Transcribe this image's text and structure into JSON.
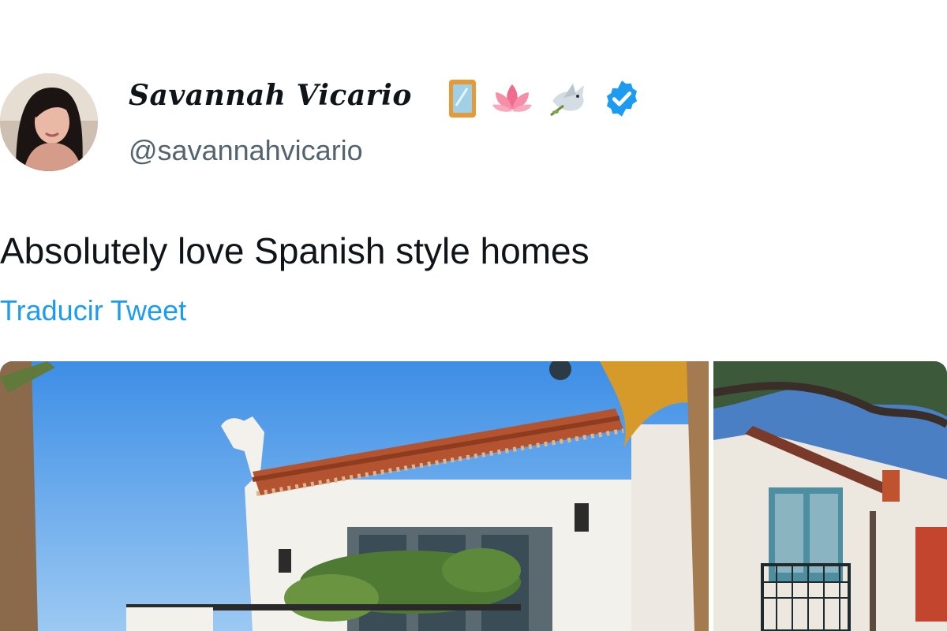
{
  "tweet": {
    "author": {
      "display_name": "Savannah Vicario",
      "handle": "@savannahvicario",
      "badges": [
        "mirror-emoji",
        "lotus-emoji",
        "dove-emoji",
        "verified-badge"
      ],
      "verified_color": "#1d9bf0"
    },
    "text": "Absolutely love Spanish style homes",
    "translate_label": "Traducir Tweet",
    "media": [
      {
        "icon": "photo-spanish-house"
      },
      {
        "icon": "photo-spanish-house-balcony"
      }
    ]
  },
  "colors": {
    "text_primary": "#0f1419",
    "text_secondary": "#536471",
    "link": "#1d9bf0"
  }
}
